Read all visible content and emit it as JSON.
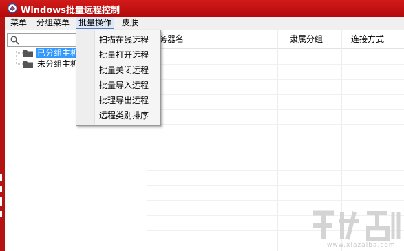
{
  "window": {
    "title": "Windows批量远程控制"
  },
  "menubar": [
    {
      "label": "菜单"
    },
    {
      "label": "分组菜单"
    },
    {
      "label": "批量操作"
    },
    {
      "label": "皮肤"
    }
  ],
  "dropdown": {
    "items": [
      "扫描在线远程",
      "批量打开远程",
      "批量关闭远程",
      "批量导入远程",
      "批理导出远程",
      "远程类别排序"
    ]
  },
  "tree": {
    "nodes": [
      {
        "label": "已分组主机",
        "selected": true
      },
      {
        "label": "未分组主机",
        "selected": false
      }
    ]
  },
  "grid": {
    "columns": [
      "务器名",
      "隶属分组",
      "连接方式"
    ]
  },
  "watermark": {
    "text": "www.xiazaiba.com"
  },
  "colors": {
    "titlebar": "#c41414",
    "selection": "#3399ff",
    "menu_active": "#dde8f8"
  }
}
